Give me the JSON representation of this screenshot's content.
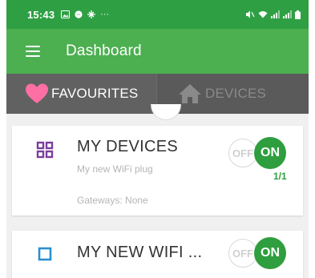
{
  "status_bar": {
    "time": "15:43",
    "more": "···"
  },
  "app_bar": {
    "title": "Dashboard"
  },
  "tabs": [
    {
      "label": "FAVOURITES",
      "icon": "heart-icon",
      "active": true
    },
    {
      "label": "DEVICES",
      "icon": "house-icon",
      "active": false
    }
  ],
  "cards": [
    {
      "name": "MY DEVICES",
      "subtitle": "My new WiFi plug",
      "gateways": "Gateways: None",
      "icon": "grid-icon",
      "toggle": {
        "off_label": "OFF",
        "on_label": "ON",
        "state": "on"
      },
      "active_count": "1/1"
    },
    {
      "name": "MY NEW WIFI ...",
      "icon": "square-icon",
      "toggle": {
        "off_label": "OFF",
        "on_label": "ON",
        "state": "on"
      }
    }
  ],
  "colors": {
    "status_bar": "#2ea043",
    "app_bar": "#4caf50",
    "tab_bar": "#5a5a5a",
    "accent_green": "#2f9e3e",
    "heart": "#ff6fa4",
    "grid_icon": "#7b3f9e",
    "square_icon": "#2a8fd0"
  }
}
